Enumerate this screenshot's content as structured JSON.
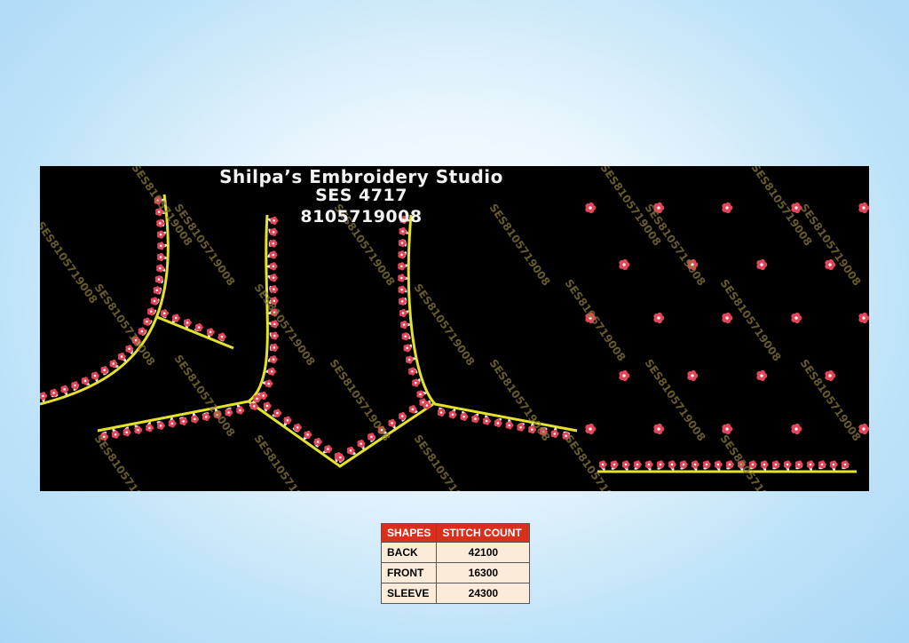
{
  "header": {
    "studio": "Shilpa’s Embroidery Studio",
    "design_code": "SES 4717",
    "phone": "8105719008"
  },
  "watermark": "SES8105719008",
  "colors": {
    "background": "#000000",
    "outline": "#e6e22a",
    "flower_red": "#e0475a",
    "leaf_white": "#e8e8e8",
    "table_header": "#d9301e",
    "table_cell": "#fdebd9"
  },
  "table": {
    "headers": [
      "SHAPES",
      "STITCH COUNT"
    ],
    "rows": [
      {
        "shape": "BACK",
        "count": "42100"
      },
      {
        "shape": "FRONT",
        "count": "16300"
      },
      {
        "shape": "SLEEVE",
        "count": "24300"
      }
    ]
  }
}
